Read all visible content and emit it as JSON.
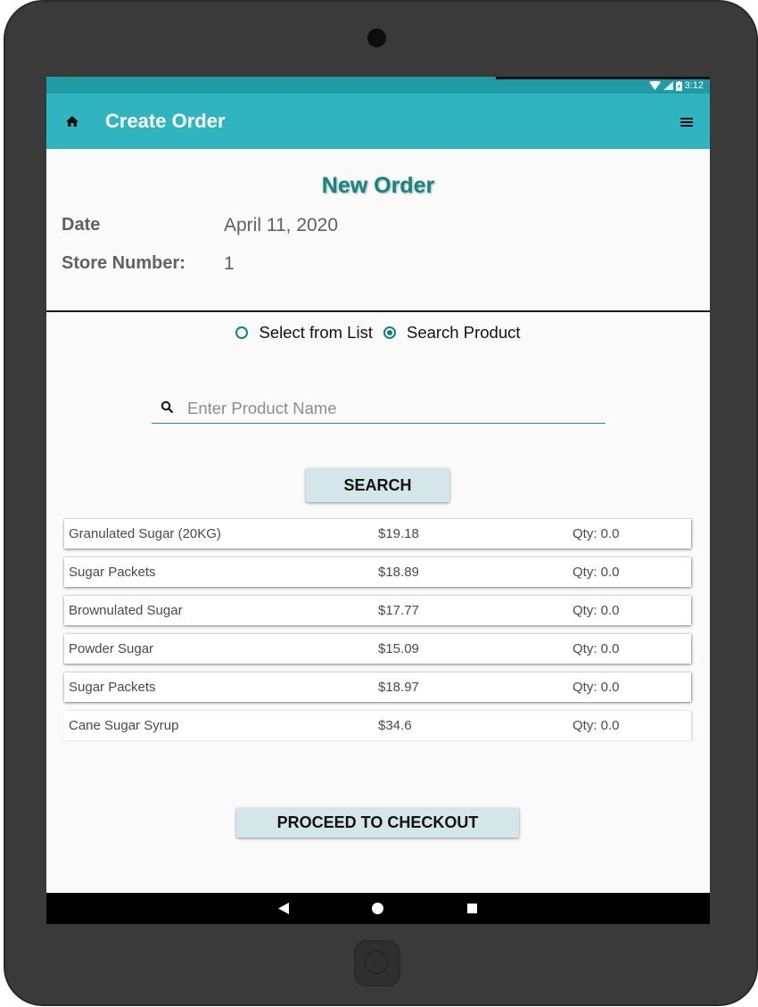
{
  "status_bar": {
    "time": "3:12"
  },
  "app_bar": {
    "title": "Create Order"
  },
  "order": {
    "heading": "New Order",
    "date_label": "Date",
    "date_value": "April 11, 2020",
    "store_label": "Store Number:",
    "store_value": "1"
  },
  "mode": {
    "option_list": "Select from List",
    "option_search": "Search Product",
    "selected": "Search Product"
  },
  "search": {
    "placeholder": "Enter Product Name",
    "value": "",
    "button_label": "SEARCH"
  },
  "products": [
    {
      "name": "Granulated Sugar (20KG)",
      "price": "$19.18",
      "qty": "Qty: 0.0"
    },
    {
      "name": "Sugar Packets",
      "price": "$18.89",
      "qty": "Qty: 0.0"
    },
    {
      "name": "Brownulated Sugar",
      "price": "$17.77",
      "qty": "Qty: 0.0"
    },
    {
      "name": "Powder Sugar",
      "price": "$15.09",
      "qty": "Qty: 0.0"
    },
    {
      "name": "Sugar Packets",
      "price": "$18.97",
      "qty": "Qty: 0.0"
    },
    {
      "name": "Cane Sugar Syrup",
      "price": "$34.6",
      "qty": "Qty: 0.0"
    }
  ],
  "checkout": {
    "button_label": "PROCEED TO CHECKOUT"
  },
  "icons": {
    "home": "home-icon",
    "menu": "menu-icon",
    "search": "search-icon",
    "wifi": "wifi-icon",
    "signal": "signal-icon",
    "battery": "battery-icon",
    "nav_back": "back-icon",
    "nav_home": "circle-icon",
    "nav_recent": "square-icon"
  },
  "colors": {
    "app_bar": "#30b4c0",
    "status_bar": "#1f9ba6",
    "accent": "#16857f",
    "button": "#d4e6e8"
  }
}
